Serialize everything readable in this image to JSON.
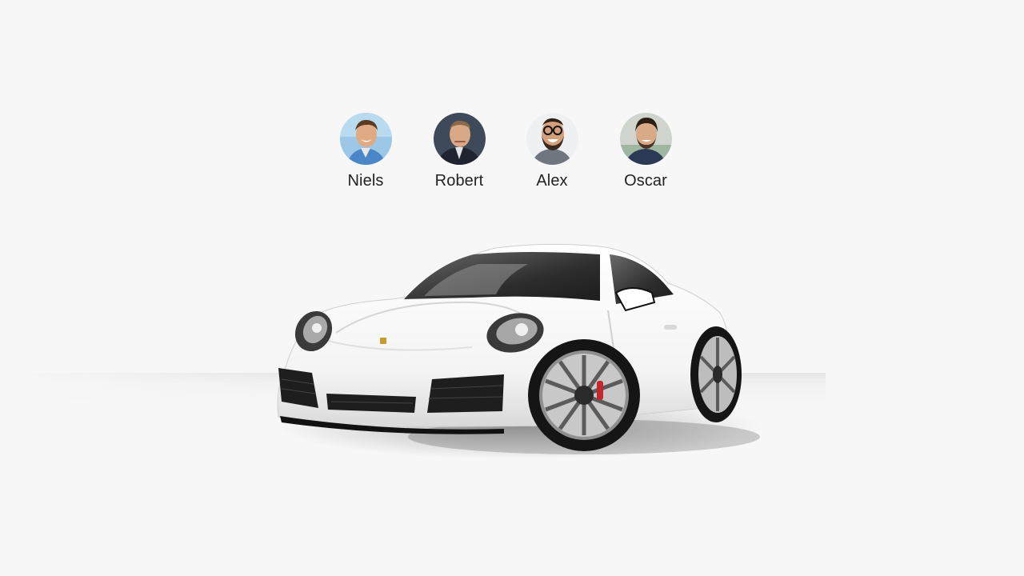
{
  "drivers": [
    {
      "name": "Niels"
    },
    {
      "name": "Robert"
    },
    {
      "name": "Alex"
    },
    {
      "name": "Oscar"
    }
  ],
  "colors": {
    "background": "#f7f7f7",
    "car_body": "#ffffff",
    "name_text": "#222222"
  }
}
